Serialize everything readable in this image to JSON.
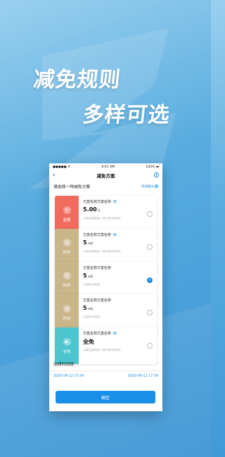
{
  "promo": {
    "line1": "减免规则",
    "line2": "多样可选"
  },
  "status": {
    "signal": "●●●●● ᯤ",
    "time": "9:41 AM",
    "battery": "100% ▬"
  },
  "nav": {
    "title": "减免方案"
  },
  "section": {
    "prompt": "请选择一种减免方案",
    "add_label": "添加备注"
  },
  "plans": [
    {
      "tile_label": "金额",
      "tile_color": "#f26b5e",
      "name": "方案名称方案名称",
      "badge": "备",
      "value": "5.00",
      "unit": "元",
      "note": "以固定金额收费（按计费时间收费）",
      "selected": false
    },
    {
      "tile_label": "时间",
      "tile_color": "#c9b68a",
      "name": "方案名称方案名称",
      "badge": "备",
      "value": "5",
      "unit": "小时",
      "note": "以固定金额收费（按计费时间收费）",
      "selected": false
    },
    {
      "tile_label": "时间",
      "tile_color": "#c9b68a",
      "name": "方案名称方案名称",
      "badge": "",
      "value": "5",
      "unit": "小时",
      "note": "以减免时间收费",
      "selected": true
    },
    {
      "tile_label": "时间",
      "tile_color": "#c9b68a",
      "name": "方案名称方案名称",
      "badge": "",
      "value": "5",
      "unit": "小时",
      "note": "以减免时间收费",
      "selected": false
    },
    {
      "tile_label": "全免",
      "tile_color": "#4cc5cf",
      "name": "方案名称方案名称",
      "badge": "备",
      "value": "全免",
      "unit": "",
      "note": "以固定金额收费（按计费时间收费）",
      "selected": false
    }
  ],
  "time_row": {
    "label": "选择时间段"
  },
  "dates": {
    "start": "2020-04-12 17:34",
    "end": "2020-04-12 17:34"
  },
  "confirm_label": "确定"
}
